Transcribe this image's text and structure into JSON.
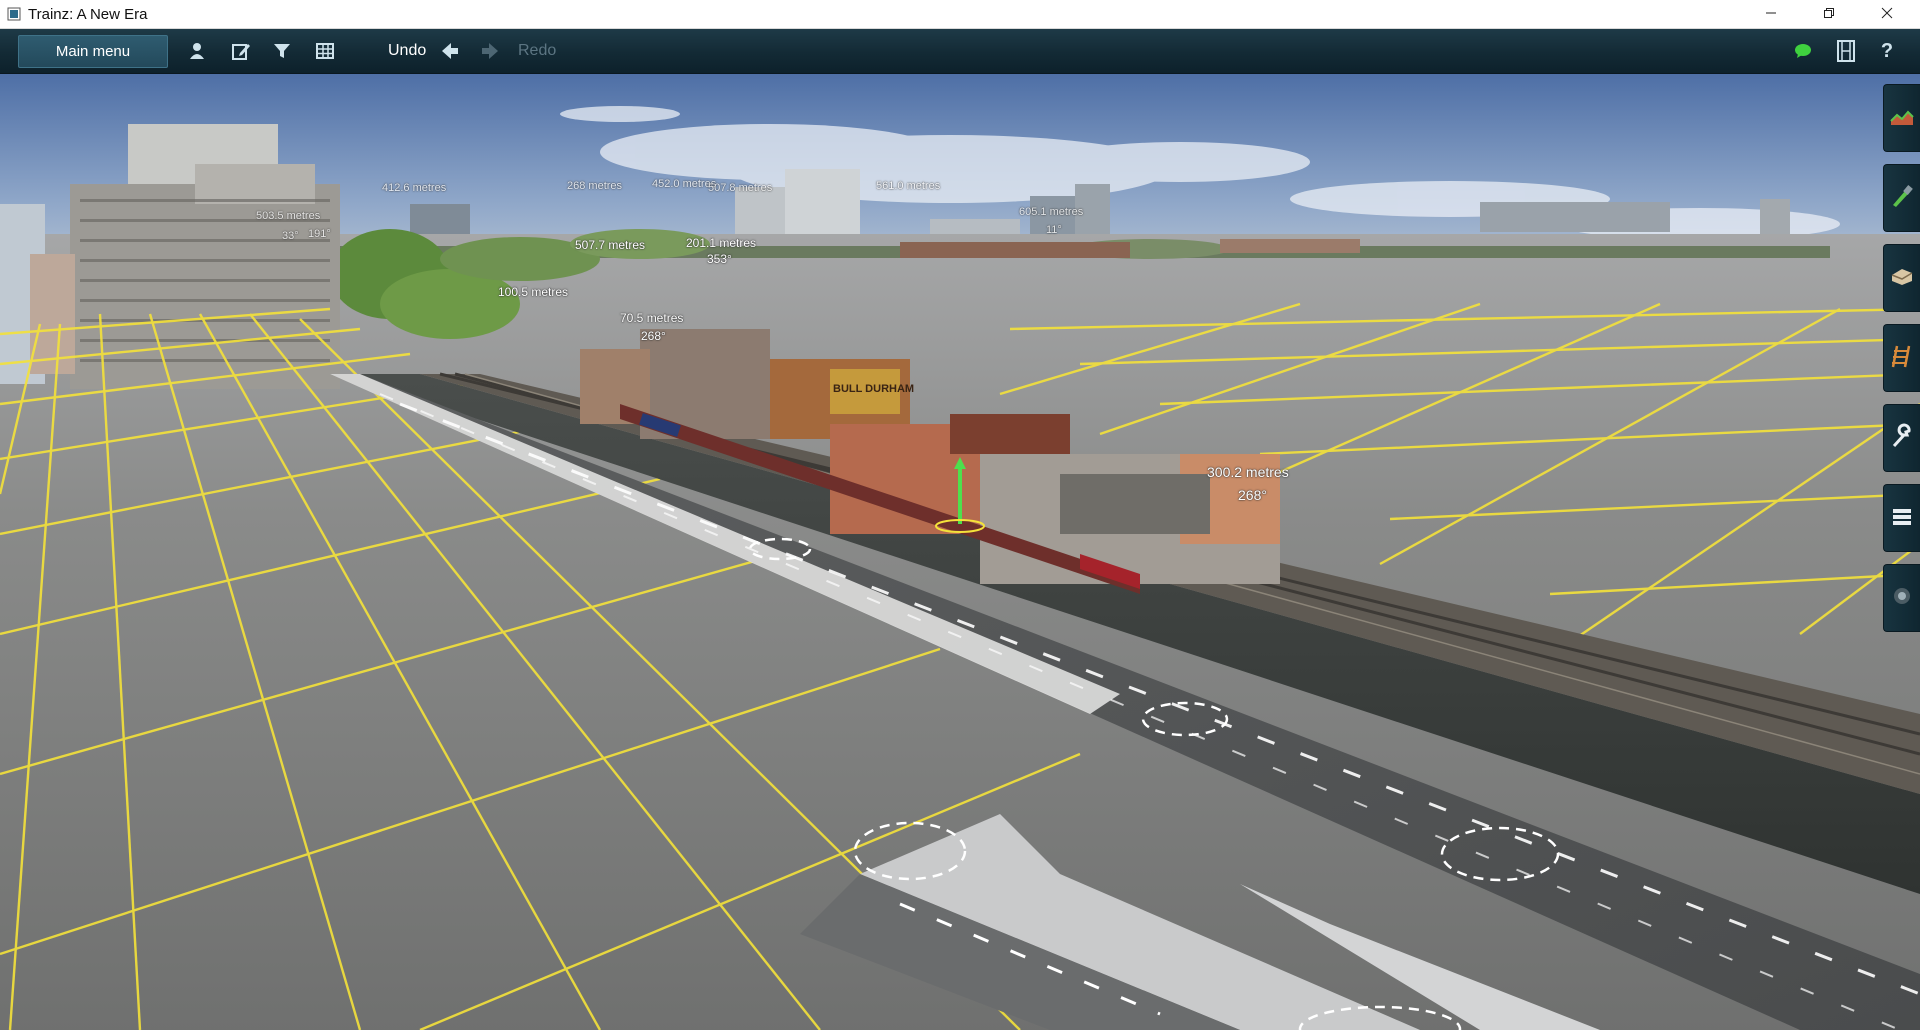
{
  "window": {
    "title": "Trainz: A New Era",
    "app_icon": "trainz-app-icon",
    "controls": [
      "minimize-icon",
      "restore-icon",
      "close-icon"
    ]
  },
  "toolbar": {
    "main_menu_label": "Main menu",
    "icons": [
      "driver-icon",
      "edit-icon",
      "filter-icon",
      "grid-icon"
    ],
    "undo_label": "Undo",
    "redo_label": "Redo",
    "status_icon": "online-status-icon",
    "status_color": "#3fd13f",
    "film_icon": "film-icon",
    "help_label": "?"
  },
  "viewport": {
    "grid_color": "#f4e23a",
    "ground_color": "#7a7a78",
    "measurements": {
      "m1": "412.6 metres",
      "m2": "503.5 metres",
      "m3": "33°",
      "m4": "191°",
      "m5": "268 metres",
      "m6": "452.0 metres",
      "m7": "507.8 metres",
      "m8": "561.0 metres",
      "m9": "605.1 metres",
      "m10": "11°",
      "m11": "507.7 metres",
      "m12": "201.1 metres",
      "m13": "353°",
      "m14": "100.5 metres",
      "m15": "70.5 metres",
      "m16": "268°",
      "m17": "300.2 metres",
      "m18": "268°"
    },
    "billboard": "BULL DURHAM"
  },
  "side_palette": {
    "tools": [
      "terrain-tool-icon",
      "paint-tool-icon",
      "objects-tool-icon",
      "track-tool-icon",
      "tools-wrench-icon",
      "layers-icon",
      "settings-icon"
    ]
  }
}
